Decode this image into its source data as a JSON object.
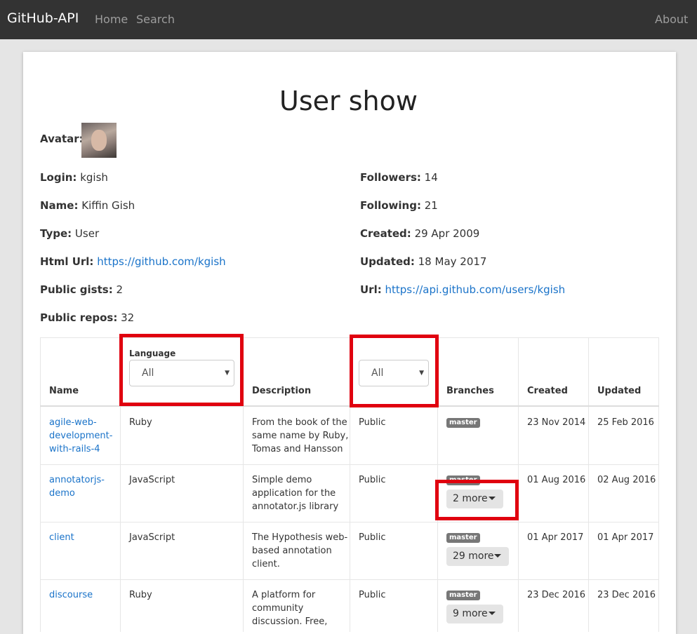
{
  "navbar": {
    "brand": "GitHub-API",
    "home": "Home",
    "search": "Search",
    "about": "About"
  },
  "page": {
    "title": "User show"
  },
  "user": {
    "avatar_label": "Avatar:",
    "login_label": "Login:",
    "login": "kgish",
    "name_label": "Name:",
    "name": "Kiffin Gish",
    "type_label": "Type:",
    "type": "User",
    "html_url_label": "Html Url:",
    "html_url": "https://github.com/kgish",
    "public_gists_label": "Public gists:",
    "public_gists": "2",
    "public_repos_label": "Public repos:",
    "public_repos": "32",
    "followers_label": "Followers:",
    "followers": "14",
    "following_label": "Following:",
    "following": "21",
    "created_label": "Created:",
    "created": "29 Apr 2009",
    "updated_label": "Updated:",
    "updated": "18 May 2017",
    "url_label": "Url:",
    "url": "https://api.github.com/users/kgish"
  },
  "table": {
    "headers": {
      "name": "Name",
      "language": "Language",
      "description": "Description",
      "branches": "Branches",
      "created": "Created",
      "updated": "Updated"
    },
    "filters": {
      "language_value": "All",
      "visibility_value": "All"
    },
    "rows": [
      {
        "name": [
          "agile-web-",
          "development-",
          "with-rails-4"
        ],
        "language": "Ruby",
        "description": [
          "From the book of the",
          "same name by Ruby,",
          "Tomas and Hansson"
        ],
        "visibility": "Public",
        "branch": "master",
        "more": "",
        "created": "23 Nov 2014",
        "updated": "25 Feb 2016"
      },
      {
        "name": [
          "annotatorjs-",
          "demo"
        ],
        "language": "JavaScript",
        "description": [
          "Simple demo",
          "application for the",
          "annotator.js library"
        ],
        "visibility": "Public",
        "branch": "master",
        "more": "2 more",
        "created": "01 Aug 2016",
        "updated": "02 Aug 2016"
      },
      {
        "name": [
          "client"
        ],
        "language": "JavaScript",
        "description": [
          "The Hypothesis web-",
          "based annotation",
          "client."
        ],
        "visibility": "Public",
        "branch": "master",
        "more": "29 more",
        "created": "01 Apr 2017",
        "updated": "01 Apr 2017"
      },
      {
        "name": [
          "discourse"
        ],
        "language": "Ruby",
        "description": [
          "A platform for",
          "community",
          "discussion. Free,"
        ],
        "visibility": "Public",
        "branch": "master",
        "more": "9 more",
        "created": "23 Dec 2016",
        "updated": "23 Dec 2016"
      }
    ]
  },
  "colors": {
    "navbar": "#333333",
    "link": "#1a73c9",
    "highlight": "#e0000f",
    "badge": "#777777"
  }
}
